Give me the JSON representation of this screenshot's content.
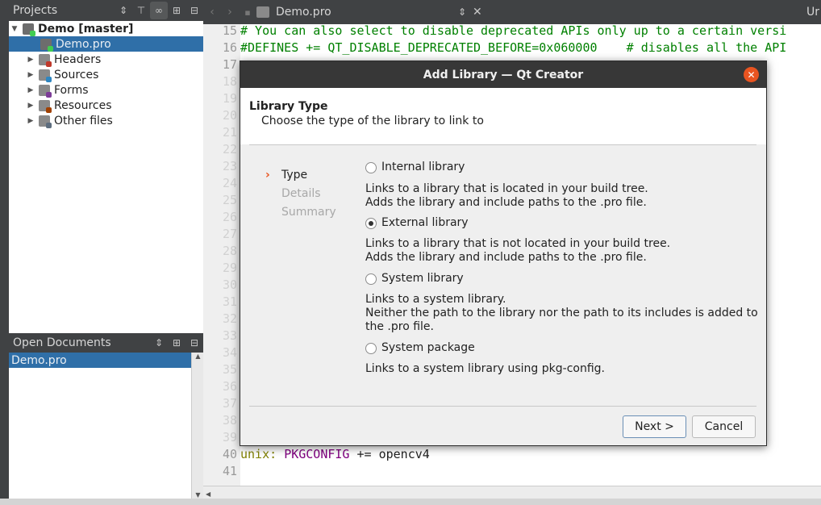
{
  "projects_pane": {
    "title": "Projects",
    "tree": [
      {
        "label": "Demo [master]",
        "expanded": "▼"
      },
      {
        "label": "Demo.pro"
      },
      {
        "label": "Headers",
        "arrow": "▶"
      },
      {
        "label": "Sources",
        "arrow": "▶"
      },
      {
        "label": "Forms",
        "arrow": "▶"
      },
      {
        "label": "Resources",
        "arrow": "▶"
      },
      {
        "label": "Other files",
        "arrow": "▶"
      }
    ]
  },
  "open_docs_pane": {
    "title": "Open Documents",
    "items": [
      "Demo.pro"
    ]
  },
  "editor": {
    "tab_label": "Demo.pro",
    "right_label": "Ur",
    "lines": [
      {
        "n": "15",
        "text": "# You can also select to disable deprecated APIs only up to a certain versi"
      },
      {
        "n": "16",
        "text": "#DEFINES += QT_DISABLE_DEPRECATED_BEFORE=0x060000    # disables all the API"
      },
      {
        "n": "17"
      },
      {
        "n": "18"
      },
      {
        "n": "19"
      },
      {
        "n": "20"
      },
      {
        "n": "21"
      },
      {
        "n": "22"
      },
      {
        "n": "23"
      },
      {
        "n": "24"
      },
      {
        "n": "25"
      },
      {
        "n": "26"
      },
      {
        "n": "27"
      },
      {
        "n": "28"
      },
      {
        "n": "29"
      },
      {
        "n": "30"
      },
      {
        "n": "31"
      },
      {
        "n": "32"
      },
      {
        "n": "33"
      },
      {
        "n": "34"
      },
      {
        "n": "35"
      },
      {
        "n": "36"
      },
      {
        "n": "37"
      },
      {
        "n": "38"
      },
      {
        "n": "39"
      },
      {
        "n": "40",
        "kw": "unix:",
        "var": "PKGCONFIG",
        "rest": "+= opencv4"
      },
      {
        "n": "41"
      }
    ]
  },
  "dialog": {
    "title": "Add Library — Qt Creator",
    "header_title": "Library Type",
    "header_subtitle": "Choose the type of the library to link to",
    "steps": [
      "Type",
      "Details",
      "Summary"
    ],
    "options": [
      {
        "label": "Internal library",
        "checked": false,
        "desc": [
          "Links to a library that is located in your build tree.",
          "Adds the library and include paths to the .pro file."
        ]
      },
      {
        "label": "External library",
        "checked": true,
        "desc": [
          "Links to a library that is not located in your build tree.",
          "Adds the library and include paths to the .pro file."
        ]
      },
      {
        "label": "System library",
        "checked": false,
        "desc": [
          "Links to a system library.",
          "Neither the path to the library nor the path to its includes is added to",
          "the .pro file."
        ]
      },
      {
        "label": "System package",
        "checked": false,
        "desc": [
          "Links to a system library using pkg-config."
        ]
      }
    ],
    "next_label": "Next >",
    "cancel_label": "Cancel"
  },
  "colors": {
    "accent": "#e95420",
    "selection": "#2f6fa8",
    "comment": "#008000"
  }
}
